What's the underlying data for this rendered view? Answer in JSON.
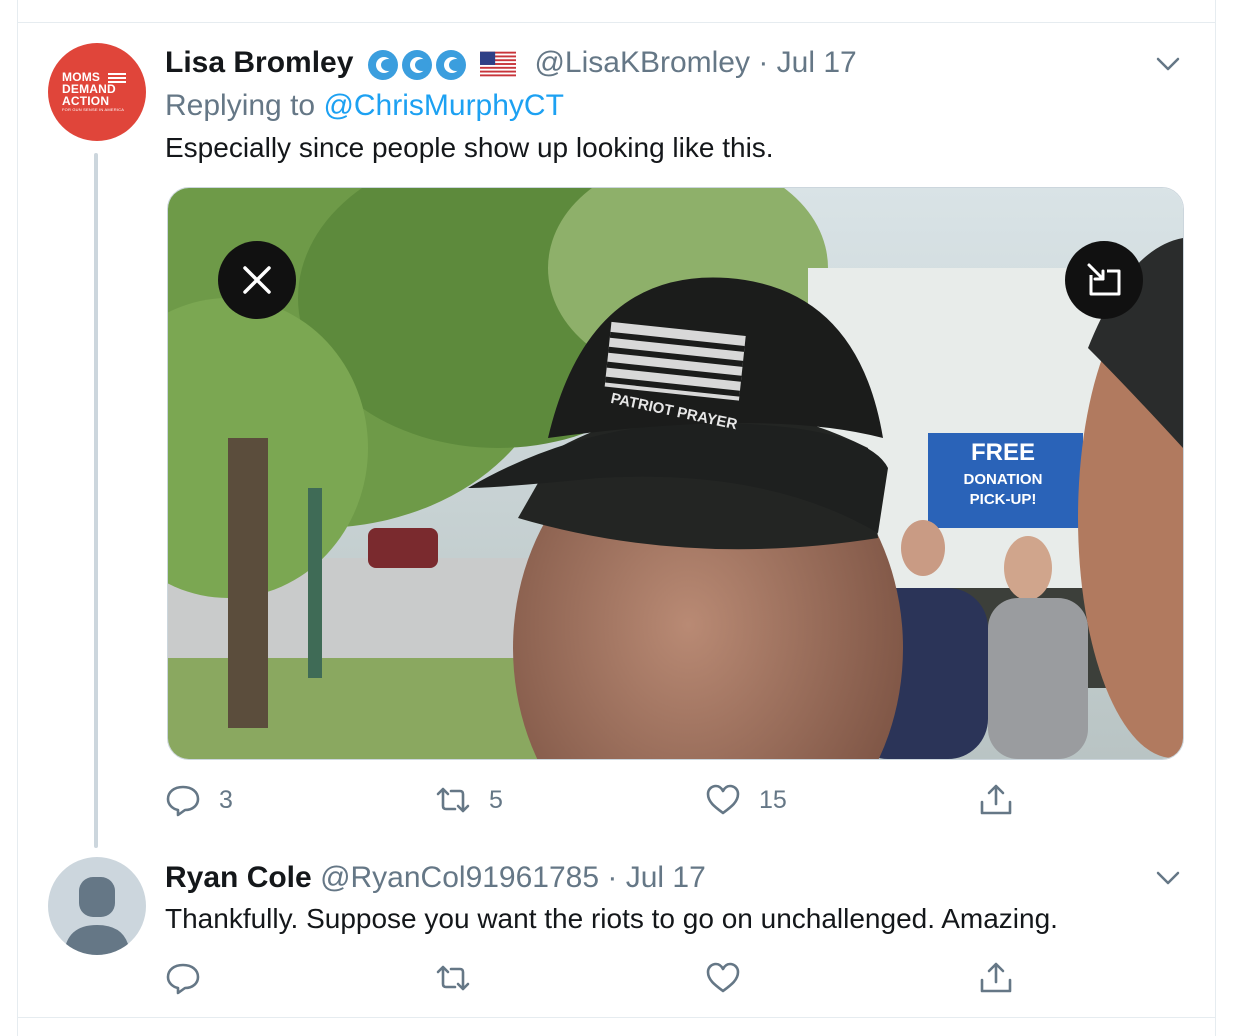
{
  "tweets": [
    {
      "author_name": "Lisa Bromley",
      "handle": "@LisaKBromley",
      "separator": "·",
      "date": "Jul 17",
      "replying_prefix": "Replying to",
      "replying_handle": "@ChrisMurphyCT",
      "text": "Especially since people show up looking like this.",
      "avatar_text": [
        "MOMS",
        "DEMAND",
        "ACTION",
        "FOR GUN SENSE IN AMERICA"
      ],
      "media_sign": [
        "FREE",
        "DONATION",
        "PICK-UP!"
      ],
      "cap_text": "PATRIOT PRAYER",
      "replies": "3",
      "retweets": "5",
      "likes": "15"
    },
    {
      "author_name": "Ryan Cole",
      "handle": "@RyanCol91961785",
      "separator": "·",
      "date": "Jul 17",
      "text": "Thankfully. Suppose you want the riots to go on unchallenged. Amazing."
    }
  ],
  "icons": [
    "wave-badge-icon",
    "us-flag-icon",
    "chevron-down-icon",
    "close-icon",
    "picture-in-picture-icon",
    "reply-icon",
    "retweet-icon",
    "like-icon",
    "share-icon",
    "default-avatar-icon"
  ],
  "colors": {
    "link": "#1da1f2",
    "muted": "#657786",
    "text": "#14171a",
    "moms_red": "#e0453a",
    "divider": "#e6ecf0"
  }
}
